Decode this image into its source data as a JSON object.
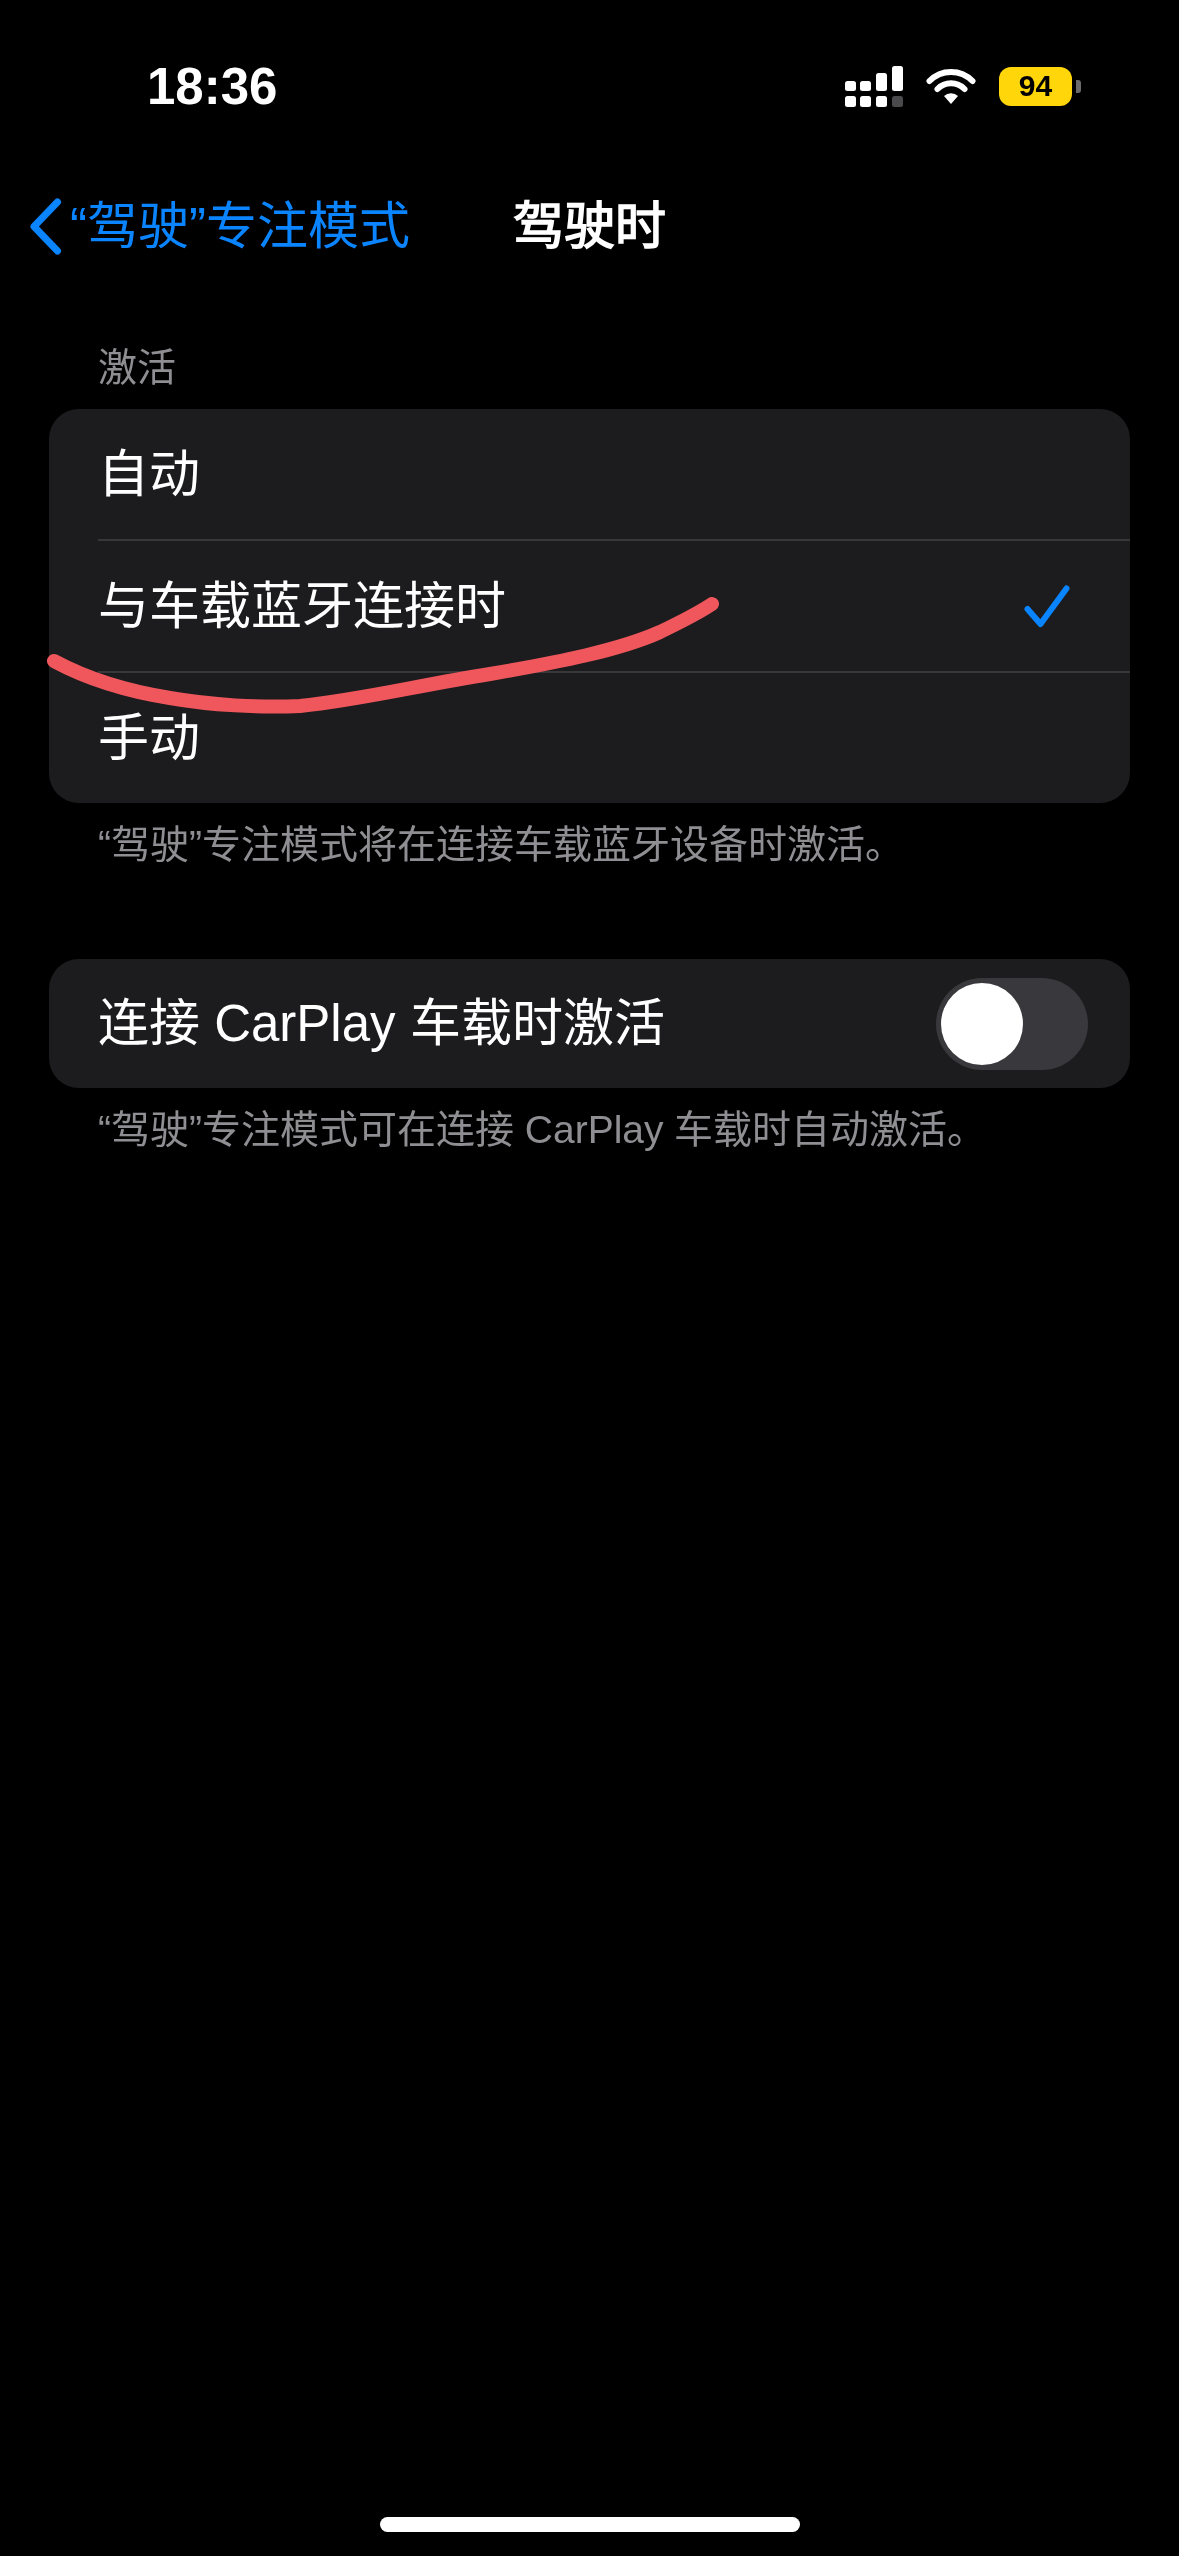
{
  "status_bar": {
    "time": "18:36",
    "battery": {
      "percent": "94",
      "low_power": true
    }
  },
  "nav_bar": {
    "back_label": "“驾驶”专注模式",
    "title": "驾驶时"
  },
  "sections": [
    {
      "header": "激活",
      "rows": [
        {
          "kind": "choice",
          "label": "自动",
          "selected": false
        },
        {
          "kind": "choice",
          "label": "与车载蓝牙连接时",
          "selected": true
        },
        {
          "kind": "choice",
          "label": "手动",
          "selected": false
        }
      ],
      "footer": "“驾驶”专注模式将在连接车载蓝牙设备时激活。"
    },
    {
      "rows": [
        {
          "kind": "toggle",
          "label": "连接 CarPlay 车载时激活",
          "on": false
        }
      ],
      "footer": "“驾驶”专注模式可在连接 CarPlay 车载时自动激活。"
    }
  ],
  "annotation": {
    "kind": "scribble"
  }
}
